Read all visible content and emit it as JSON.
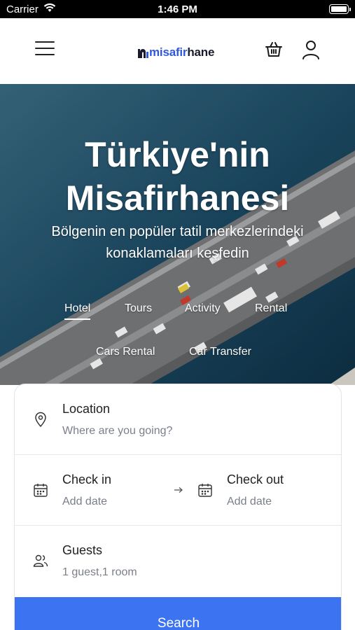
{
  "status_bar": {
    "carrier": "Carrier",
    "time": "1:46 PM"
  },
  "header": {
    "logo_part1": "misafir",
    "logo_part2": "hane"
  },
  "hero": {
    "title_line1": "Türkiye'nin",
    "title_line2": "Misafirhanesi",
    "subtitle_line1": "Bölgenin en popüler tatil merkezlerindeki",
    "subtitle_line2": "konaklamaları keşfedin",
    "tabs": [
      {
        "label": "Hotel",
        "active": true
      },
      {
        "label": "Tours",
        "active": false
      },
      {
        "label": "Activity",
        "active": false
      },
      {
        "label": "Rental",
        "active": false
      },
      {
        "label": "Cars Rental",
        "active": false
      },
      {
        "label": "Car Transfer",
        "active": false
      }
    ]
  },
  "search": {
    "location_label": "Location",
    "location_placeholder": "Where are you going?",
    "checkin_label": "Check in",
    "checkin_placeholder": "Add date",
    "checkout_label": "Check out",
    "checkout_placeholder": "Add date",
    "guests_label": "Guests",
    "guests_value": "1 guest,1 room",
    "search_label": "Search"
  },
  "colors": {
    "accent": "#3b73f0",
    "logo_blue": "#2f57e0",
    "logo_dark": "#1a1a2e"
  },
  "icons": [
    "menu-icon",
    "basket-icon",
    "user-icon",
    "location-pin-icon",
    "calendar-icon",
    "arrow-right-icon",
    "guests-icon",
    "wifi-icon",
    "battery-icon"
  ]
}
